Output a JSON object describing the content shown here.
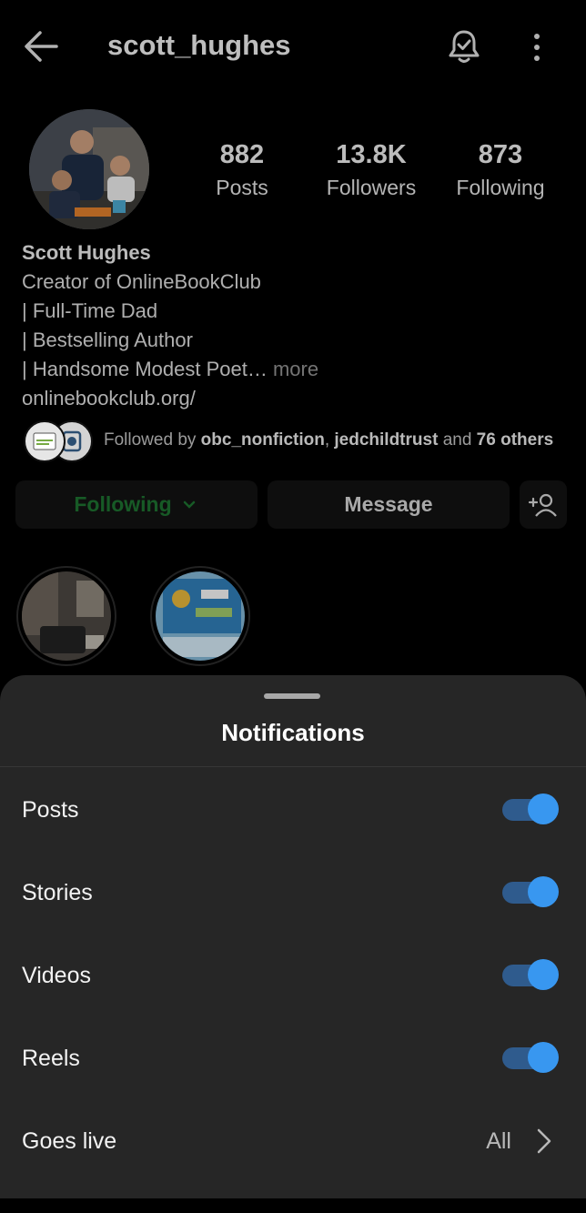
{
  "header": {
    "username": "scott_hughes"
  },
  "stats": [
    {
      "value": "882",
      "label": "Posts"
    },
    {
      "value": "13.8K",
      "label": "Followers"
    },
    {
      "value": "873",
      "label": "Following"
    }
  ],
  "bio": {
    "name": "Scott Hughes",
    "line1": "Creator of OnlineBookClub",
    "line2": "| Full-Time Dad",
    "line3": "| Bestselling Author",
    "line4": "| Handsome Modest Poet…",
    "more": "more",
    "link": "onlinebookclub.org/"
  },
  "followed_by": {
    "prefix": "Followed by",
    "user1": "obc_nonfiction",
    "sep": ",",
    "user2": "jedchildtrust",
    "and": "and",
    "others": "76 others"
  },
  "buttons": {
    "following": "Following",
    "message": "Message"
  },
  "sheet": {
    "title": "Notifications",
    "rows": [
      {
        "label": "Posts",
        "enabled": true
      },
      {
        "label": "Stories",
        "enabled": true
      },
      {
        "label": "Videos",
        "enabled": true
      },
      {
        "label": "Reels",
        "enabled": true
      }
    ],
    "live": {
      "label": "Goes live",
      "value": "All"
    }
  },
  "colors": {
    "toggle_on": "#3897f0",
    "following_green": "#1d6e2f",
    "sheet_bg": "#262626"
  }
}
